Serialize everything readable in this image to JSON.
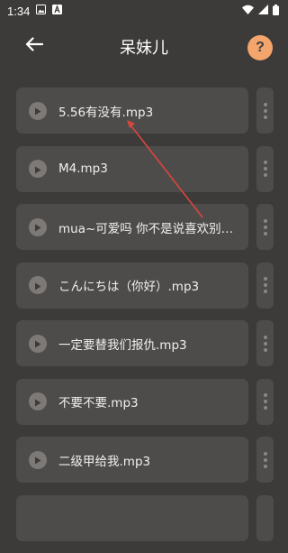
{
  "status_bar": {
    "time": "1:34"
  },
  "app_bar": {
    "title": "呆妹儿",
    "help_label": "?"
  },
  "colors": {
    "background": "#3d3b3a",
    "card": "#4e4c4b",
    "accent": "#f3a56c",
    "annotation_arrow": "#d9463c"
  },
  "files": [
    {
      "name": "5.56有没有.mp3"
    },
    {
      "name": "M4.mp3"
    },
    {
      "name": "mua~可爱吗 你不是说喜欢别人..."
    },
    {
      "name": "こんにちは（你好）.mp3"
    },
    {
      "name": "一定要替我们报仇.mp3"
    },
    {
      "name": "不要不要.mp3"
    },
    {
      "name": "二级甲给我.mp3"
    },
    {
      "name": ""
    }
  ]
}
